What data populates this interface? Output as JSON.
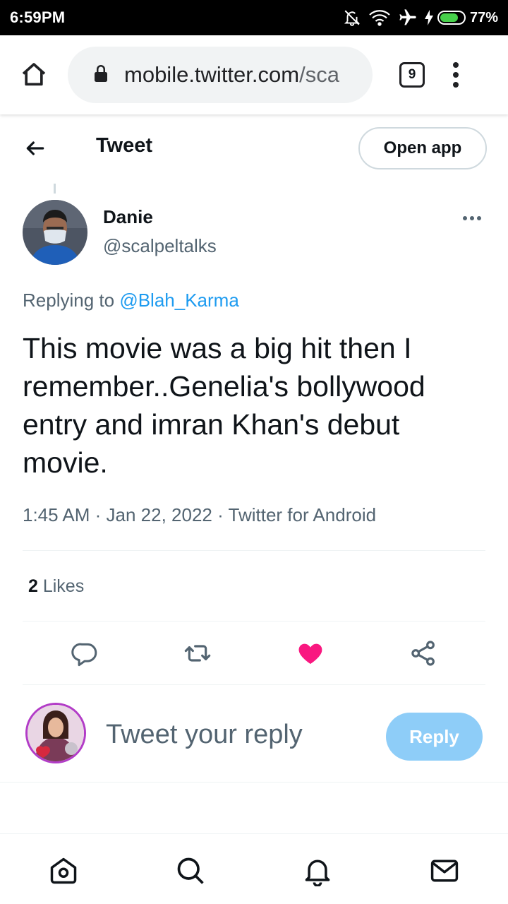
{
  "status_bar": {
    "time": "6:59PM",
    "battery_percent": "77%",
    "battery_level": 0.77,
    "icons": [
      "mute-icon",
      "wifi-icon",
      "airplane-icon",
      "charging-icon",
      "battery-icon"
    ]
  },
  "browser": {
    "url_host": "mobile.twitter.com",
    "url_rest": "/sca",
    "tab_count": "9"
  },
  "header": {
    "title": "Tweet",
    "open_app_label": "Open app"
  },
  "tweet": {
    "author_name": "Danie",
    "author_handle": "@scalpeltalks",
    "replying_prefix": "Replying to ",
    "replying_to": "@Blah_Karma",
    "text": "This movie was a big hit then I remember..Genelia's bollywood entry and imran Khan's debut movie.",
    "time": "1:45 AM",
    "separator": " · ",
    "date": "Jan 22, 2022",
    "source": "Twitter for Android",
    "likes_count": "2",
    "likes_label": " Likes",
    "liked": true
  },
  "compose": {
    "placeholder": "Tweet your reply",
    "reply_label": "Reply"
  },
  "colors": {
    "accent": "#1d9bf0",
    "like": "#f91880",
    "reply_button": "#8ecdf8"
  }
}
